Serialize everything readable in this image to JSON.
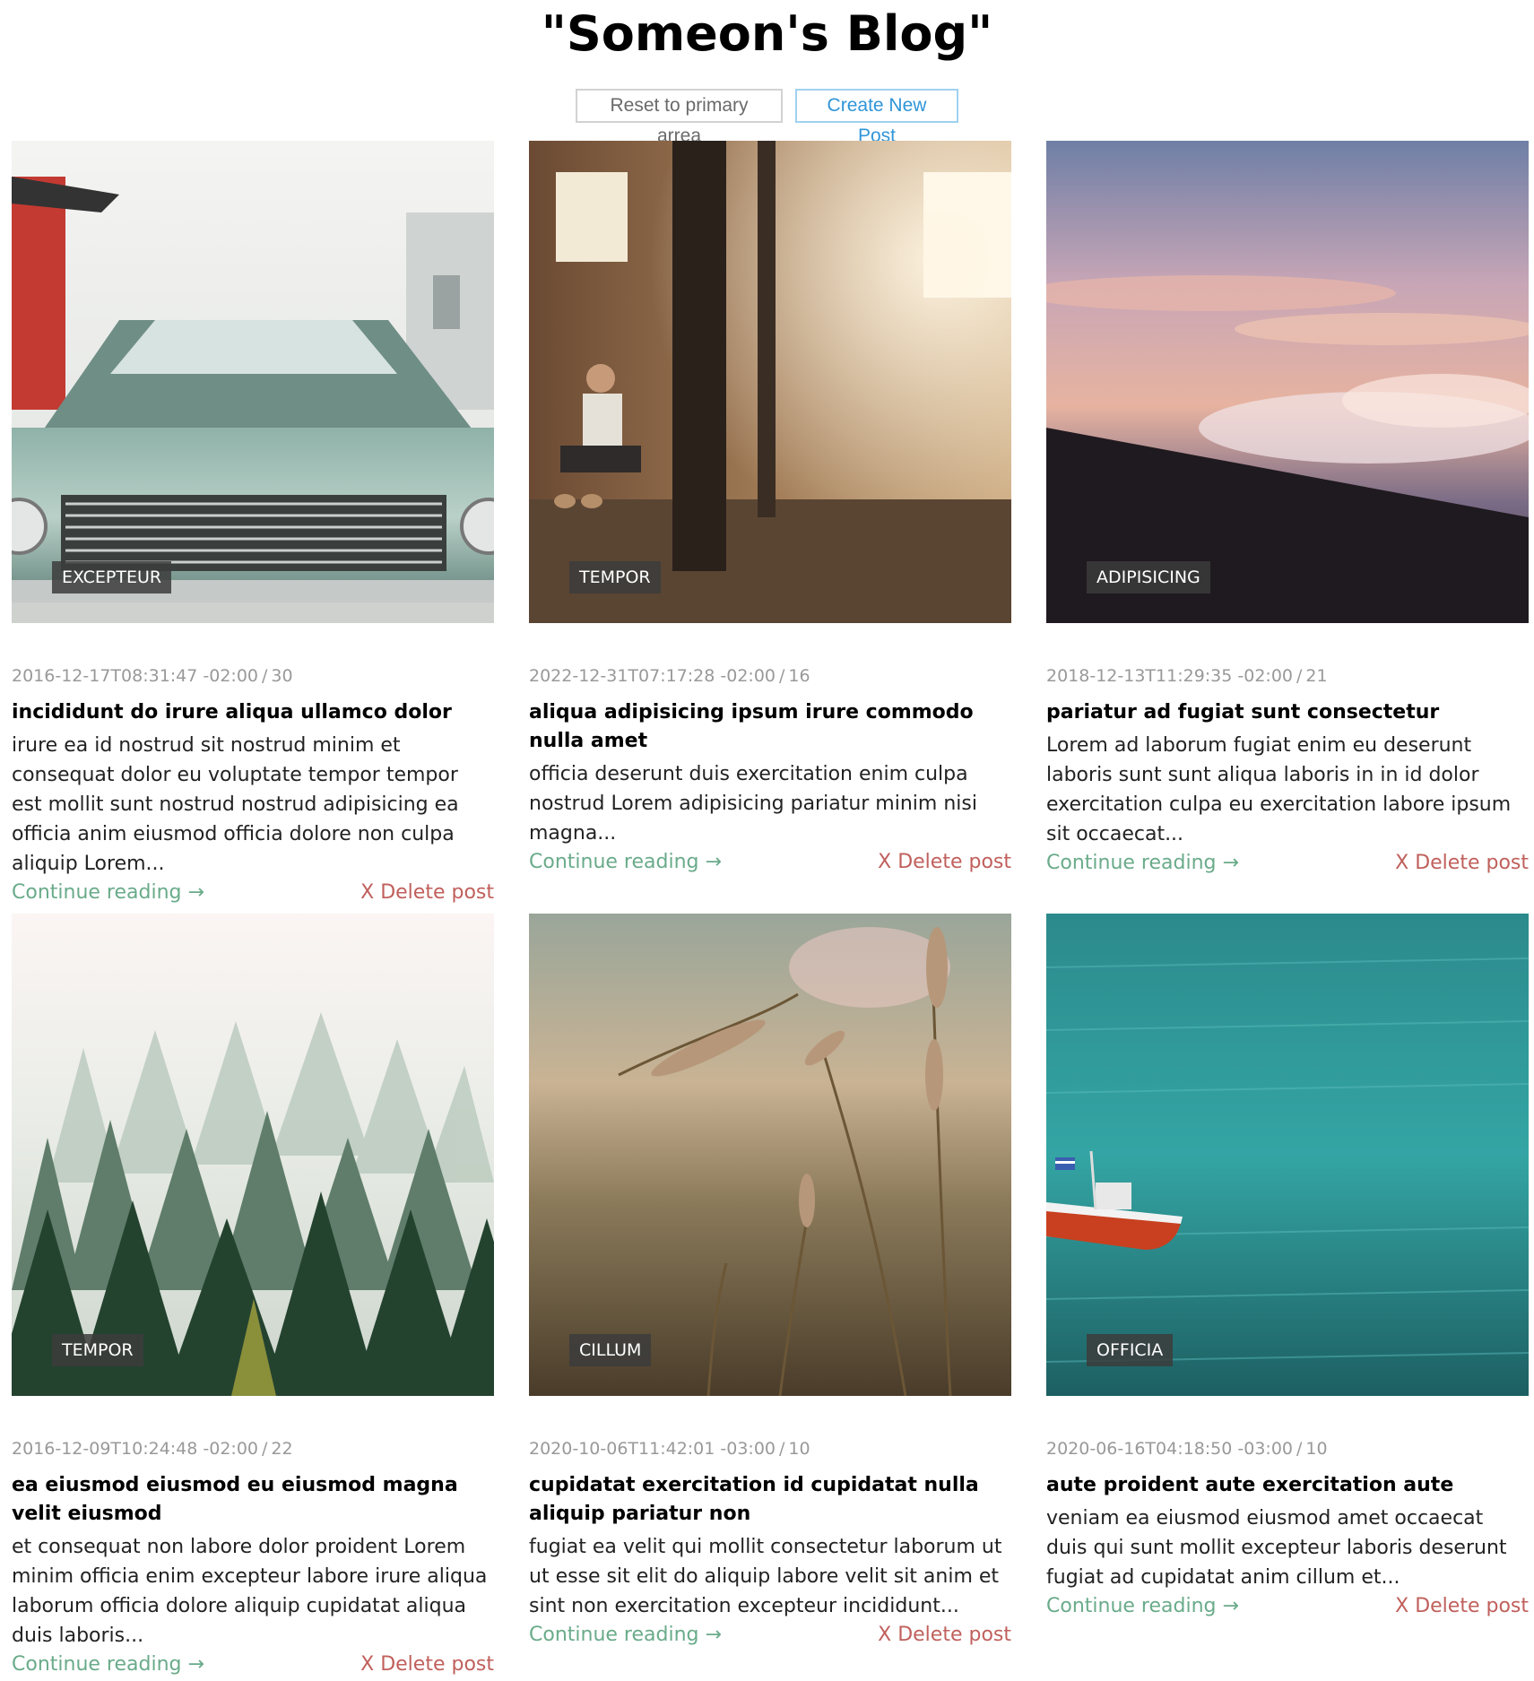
{
  "page": {
    "title": "\"Someon's Blog\""
  },
  "actions": {
    "reset_label": "Reset to primary arrea",
    "create_label": "Create New Post"
  },
  "labels": {
    "continue": "Continue reading →",
    "delete": "X Delete post"
  },
  "posts": [
    {
      "image": "continental-car-icon",
      "tag": "EXCEPTEUR",
      "date": "2016-12-17T08:31:47 -02:00",
      "count": "30",
      "title": "incididunt do irure aliqua ullamco dolor",
      "excerpt": "irure ea id nostrud sit nostrud minim et consequat dolor eu voluptate tempor tempor est mollit sunt nostrud nostrud adipisicing ea officia anim eiusmod officia dolore non culpa aliquip Lorem..."
    },
    {
      "image": "man-in-warehouse-icon",
      "tag": "TEMPOR",
      "date": "2022-12-31T07:17:28 -02:00",
      "count": "16",
      "title": "aliqua adipisicing ipsum irure commodo nulla amet",
      "excerpt": "officia deserunt duis exercitation enim culpa nostrud Lorem adipisicing pariatur minim nisi magna..."
    },
    {
      "image": "sunset-clouds-icon",
      "tag": "ADIPISICING",
      "date": "2018-12-13T11:29:35 -02:00",
      "count": "21",
      "title": "pariatur ad fugiat sunt consectetur",
      "excerpt": "Lorem ad laborum fugiat enim eu deserunt laboris sunt sunt aliqua laboris in in id dolor exercitation culpa eu exercitation labore ipsum sit occaecat..."
    },
    {
      "image": "misty-forest-icon",
      "tag": "TEMPOR",
      "date": "2016-12-09T10:24:48 -02:00",
      "count": "22",
      "title": "ea eiusmod eiusmod eu eiusmod magna velit eiusmod",
      "excerpt": "et consequat non labore dolor proident Lorem minim officia enim excepteur labore irure aliqua laborum officia dolore aliquip cupidatat aliqua duis laboris..."
    },
    {
      "image": "wheat-grass-icon",
      "tag": "CILLUM",
      "date": "2020-10-06T11:42:01 -03:00",
      "count": "10",
      "title": "cupidatat exercitation id cupidatat nulla aliquip pariatur non",
      "excerpt": "fugiat ea velit qui mollit consectetur laborum ut ut esse sit elit do aliquip labore velit sit anim et sint non exercitation excepteur incididunt..."
    },
    {
      "image": "boat-on-sea-icon",
      "tag": "OFFICIA",
      "date": "2020-06-16T04:18:50 -03:00",
      "count": "10",
      "title": "aute proident aute exercitation aute",
      "excerpt": "veniam ea eiusmod eiusmod amet occaecat duis qui sunt mollit excepteur laboris deserunt fugiat ad cupidatat anim cillum et..."
    }
  ]
}
